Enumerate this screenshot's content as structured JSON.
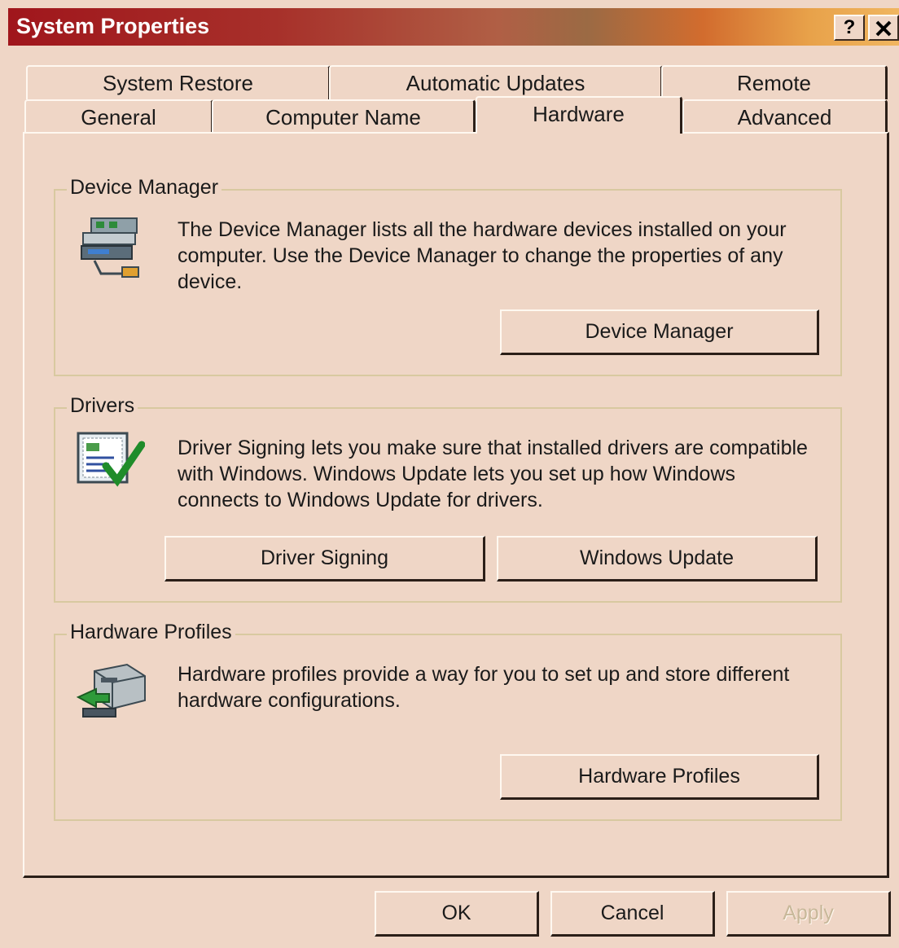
{
  "window": {
    "title": "System Properties",
    "help_button": "?",
    "close_button": "✕",
    "title_gradient": [
      "#a0161c",
      "#b05f45",
      "#d26c2e",
      "#f0b660"
    ]
  },
  "tabs": {
    "row_back": [
      {
        "label": "System Restore"
      },
      {
        "label": "Automatic Updates"
      },
      {
        "label": "Remote"
      }
    ],
    "row_front": [
      {
        "label": "General"
      },
      {
        "label": "Computer Name"
      },
      {
        "label": "Hardware",
        "active": true
      },
      {
        "label": "Advanced"
      }
    ]
  },
  "device_manager": {
    "title": "Device Manager",
    "description": "The Device Manager lists all the hardware devices installed on your computer. Use the Device Manager to change the properties of any device.",
    "button": "Device Manager",
    "icon": "device-manager-icon"
  },
  "drivers": {
    "title": "Drivers",
    "description": "Driver Signing lets you make sure that installed drivers are compatible with Windows. Windows Update lets you set up how Windows connects to Windows Update for drivers.",
    "signing_button": "Driver Signing",
    "update_button": "Windows Update",
    "icon": "driver-signing-icon"
  },
  "hardware_profiles": {
    "title": "Hardware Profiles",
    "description": "Hardware profiles provide a way for you to set up and store different hardware configurations.",
    "button": "Hardware Profiles",
    "icon": "hardware-profiles-icon"
  },
  "footer": {
    "ok": "OK",
    "cancel": "Cancel",
    "apply": "Apply",
    "apply_disabled": true
  }
}
